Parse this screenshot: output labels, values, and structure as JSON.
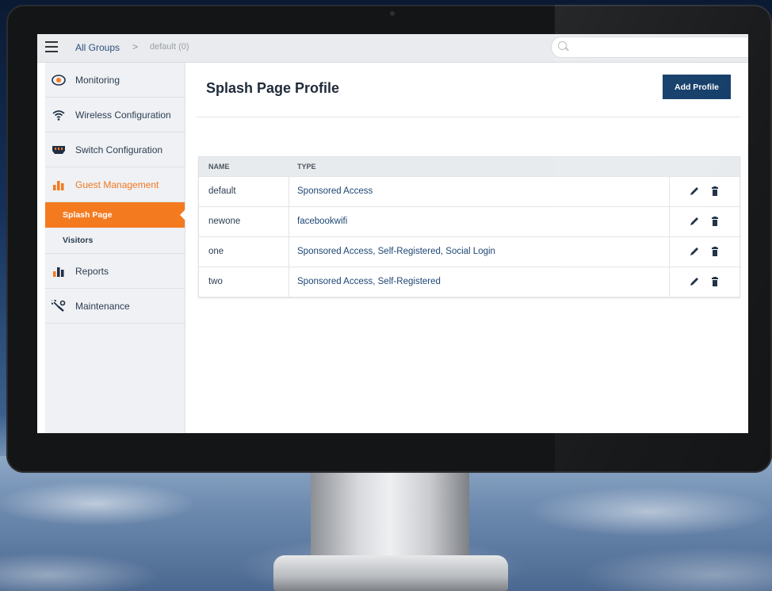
{
  "topbar": {
    "breadcrumb_root": "All Groups",
    "breadcrumb_sep": ">",
    "breadcrumb_current": "default (0)",
    "search_placeholder": ""
  },
  "sidebar": {
    "items": [
      {
        "label": "Monitoring",
        "icon": "eye-icon"
      },
      {
        "label": "Wireless Configuration",
        "icon": "wifi-icon"
      },
      {
        "label": "Switch Configuration",
        "icon": "switch-icon"
      },
      {
        "label": "Guest Management",
        "icon": "bar-chart-icon"
      },
      {
        "label": "Reports",
        "icon": "bar-chart-icon"
      },
      {
        "label": "Maintenance",
        "icon": "wrench-icon"
      }
    ],
    "subitems": [
      {
        "label": "Splash Page"
      },
      {
        "label": "Visitors"
      }
    ]
  },
  "main": {
    "title": "Splash Page Profile",
    "add_button": "Add Profile",
    "columns": [
      "NAME",
      "TYPE"
    ],
    "rows": [
      {
        "name": "default",
        "type": "Sponsored Access"
      },
      {
        "name": "newone",
        "type": "facebookwifi"
      },
      {
        "name": "one",
        "type": "Sponsored Access, Self-Registered, Social Login"
      },
      {
        "name": "two",
        "type": "Sponsored Access, Self-Registered"
      }
    ]
  },
  "colors": {
    "accent": "#f47a20",
    "primary_button": "#0f3a66",
    "link_text": "#1d4674"
  }
}
